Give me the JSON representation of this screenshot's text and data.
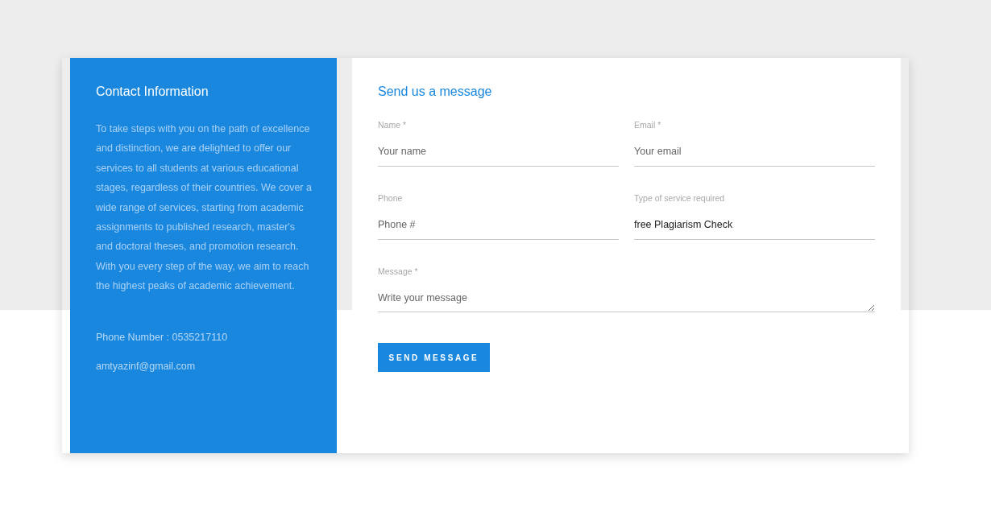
{
  "contact_info": {
    "title": "Contact Information",
    "description": "To take steps with you on the path of excellence and distinction, we are delighted to offer our services to all students at various educational stages, regardless of their countries. We cover a wide range of services, starting from academic assignments to published research, master's and doctoral theses, and promotion research. With you every step of the way, we aim to reach the highest peaks of academic achievement.",
    "phone": "Phone Number : 0535217110",
    "email": "amtyazinf@gmail.com"
  },
  "form": {
    "title": "Send us a message",
    "fields": [
      {
        "kind": "text",
        "label": "Name *",
        "placeholder": "Your name"
      },
      {
        "kind": "text",
        "label": "Email *",
        "placeholder": "Your email"
      },
      {
        "kind": "text",
        "label": "Phone",
        "placeholder": "Phone #"
      },
      {
        "kind": "text",
        "label": "Type of service required",
        "value": "free Plagiarism Check"
      },
      {
        "kind": "textarea",
        "label": "Message *",
        "placeholder": "Write your message"
      }
    ],
    "submit": "SEND MESSAGE"
  }
}
